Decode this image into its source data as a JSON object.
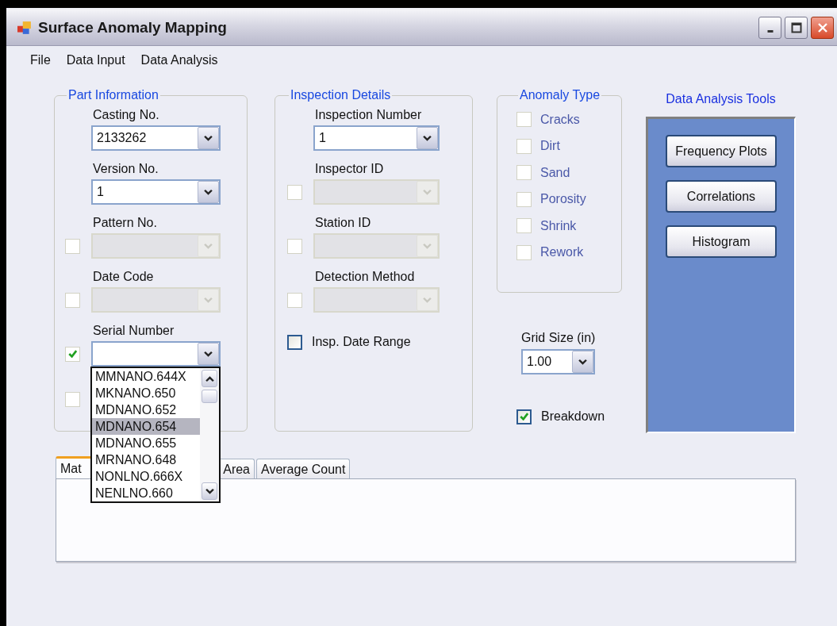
{
  "window": {
    "title": "Surface Anomaly Mapping"
  },
  "menu": [
    "File",
    "Data Input",
    "Data Analysis"
  ],
  "part_information": {
    "title": "Part Information",
    "fields": [
      {
        "kind": "combo",
        "label": "Casting No.",
        "value": "2133262",
        "enabled": true
      },
      {
        "kind": "combo",
        "label": "Version No.",
        "value": "1",
        "enabled": true
      },
      {
        "kind": "combo",
        "label": "Pattern No.",
        "enabled": false,
        "checked": false
      },
      {
        "kind": "combo",
        "label": "Date Code",
        "enabled": false,
        "checked": false
      },
      {
        "kind": "combo",
        "label": "Serial Number",
        "enabled": true,
        "checked": true,
        "options": [
          {
            "text": "MMNANO.644X",
            "selected": false
          },
          {
            "text": "MKNANO.650",
            "selected": false
          },
          {
            "text": "MDNANO.652",
            "selected": false
          },
          {
            "text": "MDNANO.654",
            "selected": true
          },
          {
            "text": "MDNANO.655",
            "selected": false
          },
          {
            "text": "MRNANO.648",
            "selected": false
          },
          {
            "text": "NONLNO.666X",
            "selected": false
          },
          {
            "text": "NENLNO.660",
            "selected": false
          }
        ]
      },
      {
        "kind": "checkbox",
        "checked": false
      }
    ]
  },
  "inspection_details": {
    "title": "Inspection Details",
    "fields": [
      {
        "kind": "combo",
        "label": "Inspection Number",
        "value": "1",
        "enabled": true
      },
      {
        "kind": "combo",
        "label": "Inspector ID",
        "enabled": false,
        "checked": false
      },
      {
        "kind": "combo",
        "label": "Station ID",
        "enabled": false,
        "checked": false
      },
      {
        "kind": "combo",
        "label": "Detection Method",
        "enabled": false,
        "checked": false
      },
      {
        "kind": "checkbox",
        "label": "Insp. Date Range",
        "checked": false
      }
    ]
  },
  "anomaly_type": {
    "title": "Anomaly Type",
    "items": [
      {
        "label": "Cracks",
        "checked": false
      },
      {
        "label": "Dirt",
        "checked": false
      },
      {
        "label": "Sand",
        "checked": false
      },
      {
        "label": "Porosity",
        "checked": false
      },
      {
        "label": "Shrink",
        "checked": false
      },
      {
        "label": "Rework",
        "checked": false
      }
    ]
  },
  "grid_size": {
    "label": "Grid Size (in)",
    "value": "1.00"
  },
  "breakdown": {
    "label": "Breakdown",
    "checked": true
  },
  "analysis_tools": {
    "title": "Data Analysis Tools",
    "buttons": [
      "Frequency Plots",
      "Correlations",
      "Histogram"
    ]
  },
  "tabs": [
    {
      "label": "Mat",
      "selected": true
    },
    {
      "label": "Area",
      "selected": false
    },
    {
      "label": "Average Count",
      "selected": false
    }
  ]
}
